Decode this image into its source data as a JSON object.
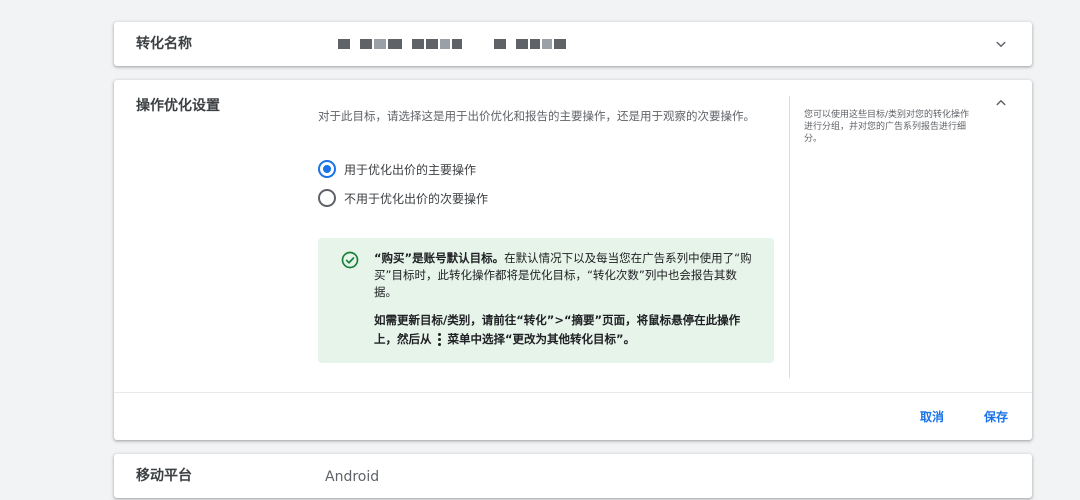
{
  "conversion_name": {
    "label": "转化名称",
    "value_masked": true,
    "expand_icon": "chevron-down-icon"
  },
  "optimization": {
    "label": "操作优化设置",
    "description": "对于此目标，请选择这是用于出价优化和报告的主要操作，还是用于观察的次要操作。",
    "options": [
      {
        "label": "用于优化出价的主要操作",
        "selected": true
      },
      {
        "label": "不用于优化出价的次要操作",
        "selected": false
      }
    ],
    "info": {
      "icon": "check-circle-icon",
      "bold_lead": "“购买”是账号默认目标。",
      "text": "在默认情况下以及每当您在广告系列中使用了“购买”目标时，此转化操作都将是优化目标，“转化次数”列中也会报告其数据。",
      "instruction_part1": "如需更新目标/类别，请前往“转化”>“摘要”页面，将鼠标悬停在此操作上，然后从",
      "instruction_part2": "菜单中选择“更改为其他转化目标”。",
      "menu_icon": "more-vert-icon"
    },
    "side_note": "您可以使用这些目标/类别对您的转化操作进行分组，并对您的广告系列报告进行细分。",
    "collapse_icon": "chevron-up-icon",
    "cancel_label": "取消",
    "save_label": "保存"
  },
  "mobile_platform": {
    "label": "移动平台",
    "value": "Android"
  },
  "colors": {
    "accent": "#1a73e8",
    "info_bg": "#e6f4ea",
    "info_icon": "#188038"
  }
}
